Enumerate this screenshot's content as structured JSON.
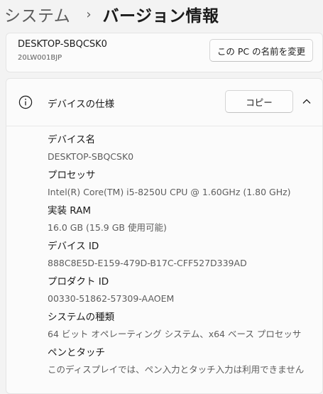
{
  "breadcrumb": {
    "parent": "システム",
    "separator": "›",
    "current": "バージョン情報"
  },
  "device": {
    "name": "DESKTOP-SBQCSK0",
    "model": "20LW001BJP",
    "rename_button": "この PC の名前を変更"
  },
  "device_specs": {
    "title": "デバイスの仕様",
    "copy_button": "コピー",
    "icon": "info-icon",
    "collapse_icon": "chevron-up-icon",
    "items": [
      {
        "label": "デバイス名",
        "value": "DESKTOP-SBQCSK0"
      },
      {
        "label": "プロセッサ",
        "value": "Intel(R) Core(TM) i5-8250U CPU @ 1.60GHz (1.80 GHz)"
      },
      {
        "label": "実装 RAM",
        "value": "16.0 GB (15.9 GB 使用可能)"
      },
      {
        "label": "デバイス ID",
        "value": "888C8E5D-E159-479D-B17C-CFF527D339AD"
      },
      {
        "label": "プロダクト ID",
        "value": "00330-51862-57309-AAOEM"
      },
      {
        "label": "システムの種類",
        "value": "64 ビット オペレーティング システム、x64 ベース プロセッサ"
      },
      {
        "label": "ペンとタッチ",
        "value": "このディスプレイでは、ペン入力とタッチ入力は利用できません"
      }
    ]
  }
}
